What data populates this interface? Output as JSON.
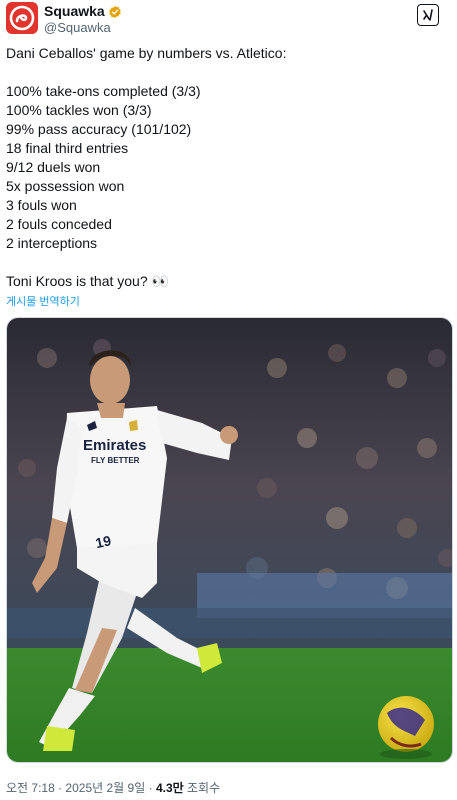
{
  "author": {
    "display_name": "Squawka",
    "handle": "@Squawka"
  },
  "tweet": {
    "text": "Dani Ceballos' game by numbers vs. Atletico:\n\n100% take-ons completed (3/3)\n100% tackles won (3/3)\n99% pass accuracy (101/102)\n18 final third entries\n9/12 duels won\n5x possession won\n3 fouls won\n2 fouls conceded\n2 interceptions\n\nToni Kroos is that you? 👀",
    "translate_label": "게시물 번역하기"
  },
  "media": {
    "shirt_sponsor": "Emirates",
    "shirt_slogan": "FLY BETTER",
    "shirt_number": "19"
  },
  "meta": {
    "time_date": "오전 7:18 · 2025년 2월 9일 · ",
    "views_count": "4.3만",
    "views_label": " 조회수"
  },
  "colors": {
    "brand": "#e0342d",
    "link": "#1d9bf0",
    "verified": "#e2a400"
  }
}
